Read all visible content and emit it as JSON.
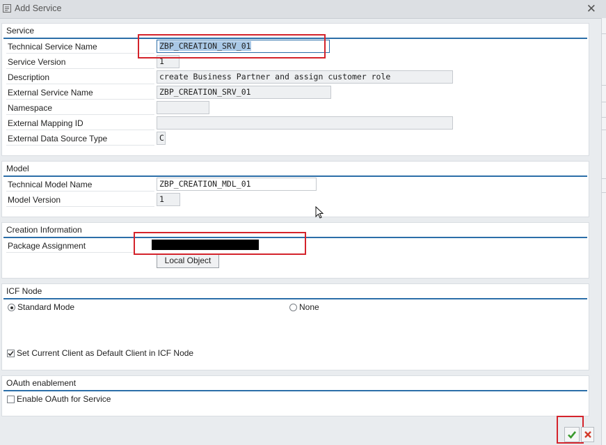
{
  "window": {
    "title": "Add Service"
  },
  "service": {
    "title": "Service",
    "technical_name_label": "Technical Service Name",
    "technical_name_value": "ZBP_CREATION_SRV_01",
    "version_label": "Service Version",
    "version_value": "1",
    "description_label": "Description",
    "description_value": "create Business Partner and assign customer role",
    "external_name_label": "External Service Name",
    "external_name_value": "ZBP_CREATION_SRV_01",
    "namespace_label": "Namespace",
    "namespace_value": "",
    "mapping_label": "External Mapping ID",
    "mapping_value": "",
    "source_type_label": "External Data Source Type",
    "source_type_value": "C"
  },
  "model": {
    "title": "Model",
    "technical_name_label": "Technical Model Name",
    "technical_name_value": "ZBP_CREATION_MDL_01",
    "version_label": "Model Version",
    "version_value": "1"
  },
  "creation": {
    "title": "Creation Information",
    "package_label": "Package Assignment",
    "package_value": "",
    "local_object_button": "Local Object"
  },
  "icf": {
    "title": "ICF Node",
    "standard_mode_label": "Standard Mode",
    "standard_mode_selected": true,
    "none_label": "None",
    "default_client_label": "Set Current Client as Default Client in ICF Node",
    "default_client_checked": true
  },
  "oauth": {
    "title": "OAuth enablement",
    "enable_label": "Enable OAuth for Service",
    "enable_checked": false
  },
  "footer": {
    "confirm_icon": "green-check-icon",
    "cancel_icon": "red-x-icon"
  },
  "colors": {
    "highlight_red": "#d4232b",
    "group_line": "#2b6ea8",
    "confirm_green": "#3a9a2e",
    "cancel_red": "#d23a2a"
  }
}
